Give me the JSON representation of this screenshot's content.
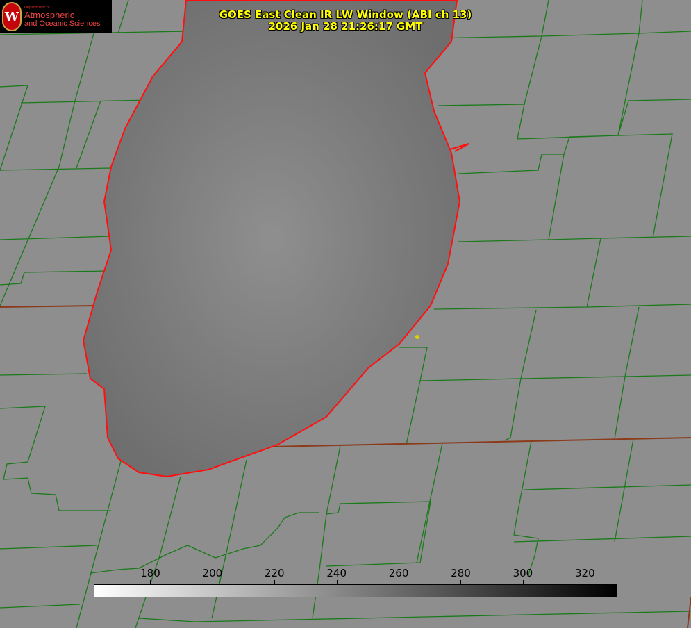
{
  "logo": {
    "dept": "Department of",
    "line1": "Atmospheric",
    "line2": "and Oceanic Sciences",
    "seal": "W"
  },
  "title": "GOES East Clean IR LW Window (ABI ch 13)",
  "timestamp": "2026 Jan 28 21:26:17 GMT",
  "colorbar": {
    "min": 162,
    "max": 330,
    "ticks": [
      "180",
      "200",
      "220",
      "240",
      "260",
      "280",
      "300",
      "320"
    ],
    "colors": [
      "#ffffff",
      "#000000"
    ]
  },
  "colors": {
    "county": "#1a7a1a",
    "lake_outline": "#ff1010",
    "state": "#8b3a1a",
    "marker": "#e0d000"
  }
}
